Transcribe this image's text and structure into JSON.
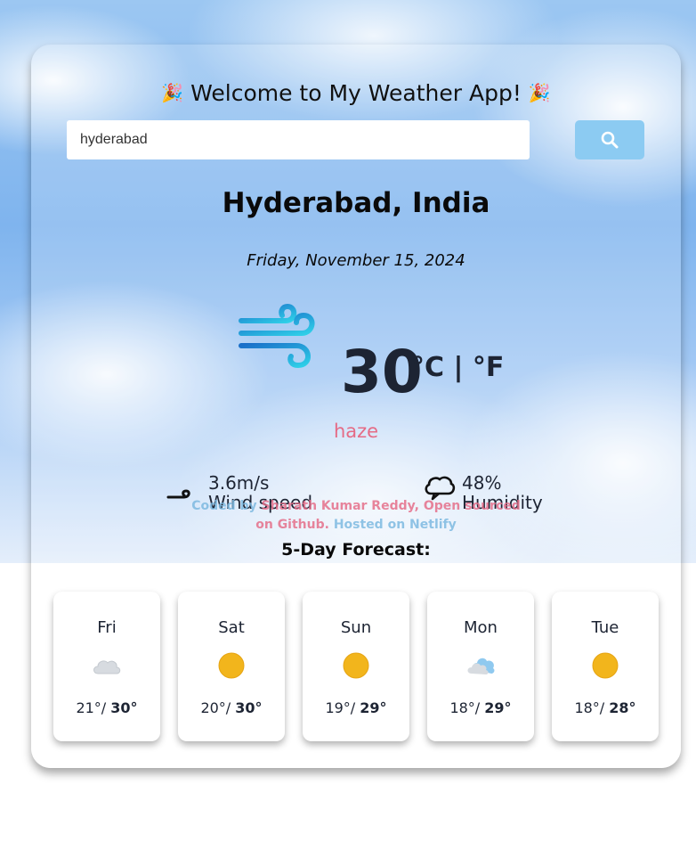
{
  "header": {
    "title": "Welcome to My Weather App!",
    "emoji_left": "🎉",
    "emoji_right": "🎉"
  },
  "search": {
    "value": "hyderabad",
    "button_icon": "search-icon"
  },
  "current": {
    "city": "Hyderabad, India",
    "date": "Friday, November 15, 2024",
    "icon": "wind-icon",
    "temperature": "30",
    "units": "°C | °F",
    "description": "haze",
    "wind_value": "3.6m/s",
    "wind_label": "Wind speed",
    "humidity_value": "48%",
    "humidity_label": "Humidity"
  },
  "credit": {
    "coded_by": "Coded by",
    "author": "Sharath Kumar Reddy,",
    "open_sourced": "Open sourced on",
    "github": "Github.",
    "hosted": "Hosted on Netlify"
  },
  "forecast": {
    "title": "5-Day Forecast:",
    "days": [
      {
        "day": "Fri",
        "min": "21°/",
        "max": "30°",
        "icon": "cloud-icon"
      },
      {
        "day": "Sat",
        "min": "20°/",
        "max": "30°",
        "icon": "sun-icon"
      },
      {
        "day": "Sun",
        "min": "19°/",
        "max": "29°",
        "icon": "sun-icon"
      },
      {
        "day": "Mon",
        "min": "18°/",
        "max": "29°",
        "icon": "cloud-sun-icon"
      },
      {
        "day": "Tue",
        "min": "18°/",
        "max": "28°",
        "icon": "sun-icon"
      }
    ]
  },
  "colors": {
    "accent": "#8ccbf2",
    "description": "#e56b86",
    "text": "#1d2433"
  }
}
